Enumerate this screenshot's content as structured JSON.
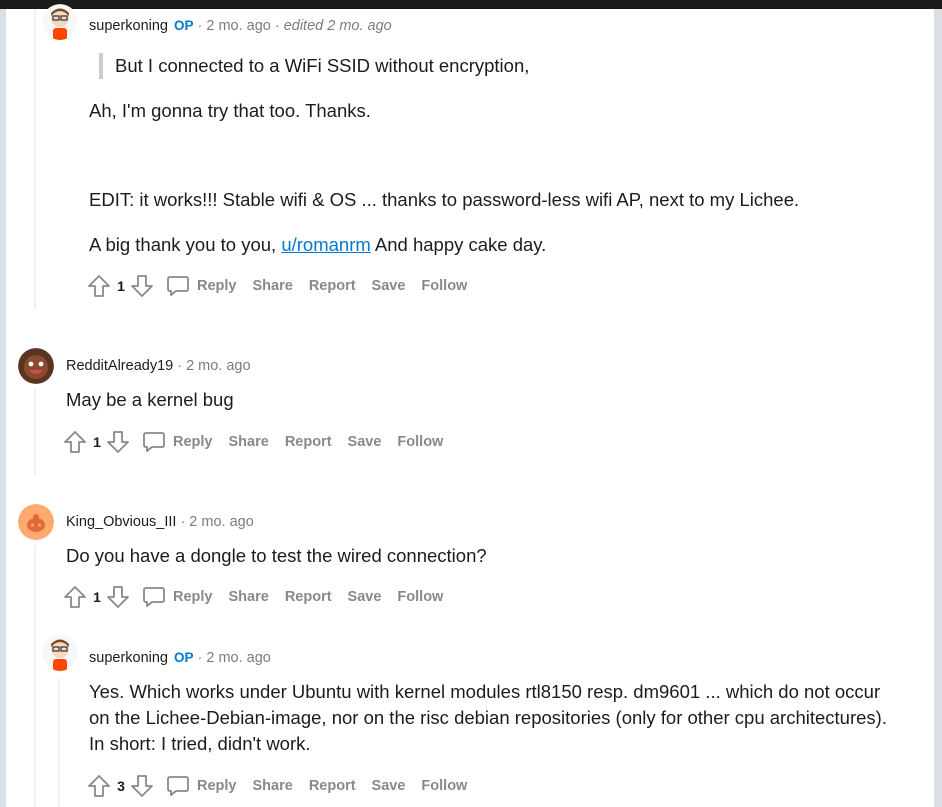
{
  "comments": [
    {
      "author": "superkoning",
      "op": "OP",
      "time": "2 mo. ago",
      "edited": "edited 2 mo. ago",
      "quote": "But I connected to a WiFi SSID without encryption,",
      "line1": "Ah, I'm gonna try that too. Thanks.",
      "line2": "EDIT: it works!!! Stable wifi & OS ... thanks to password-less wifi AP, next to my Lichee.",
      "line3_pre": "A big thank you to you, ",
      "line3_link": "u/romanrm",
      "line3_post": " And happy cake day.",
      "score": "1"
    },
    {
      "author": "RedditAlready19",
      "time": "2 mo. ago",
      "text": "May be a kernel bug",
      "score": "1"
    },
    {
      "author": "King_Obvious_III",
      "time": "2 mo. ago",
      "text": "Do you have a dongle to test the wired connection?",
      "score": "1"
    },
    {
      "author": "superkoning",
      "op": "OP",
      "time": "2 mo. ago",
      "text": "Yes. Which works under Ubuntu with kernel modules rtl8150 resp. dm9601 ... which do not occur on the Lichee-Debian-image, nor on the risc debian repositories (only for other cpu architectures). In short: I tried, didn't work.",
      "score": "3"
    }
  ],
  "actions": {
    "reply": "Reply",
    "share": "Share",
    "report": "Report",
    "save": "Save",
    "follow": "Follow"
  },
  "icons": {
    "upvote": "upvote-arrow-icon",
    "downvote": "downvote-arrow-icon",
    "reply": "speech-bubble-icon"
  },
  "colors": {
    "op": "#0079d3",
    "link": "#0079d3",
    "action_text": "#878a8c",
    "background": "#dae0e6"
  }
}
